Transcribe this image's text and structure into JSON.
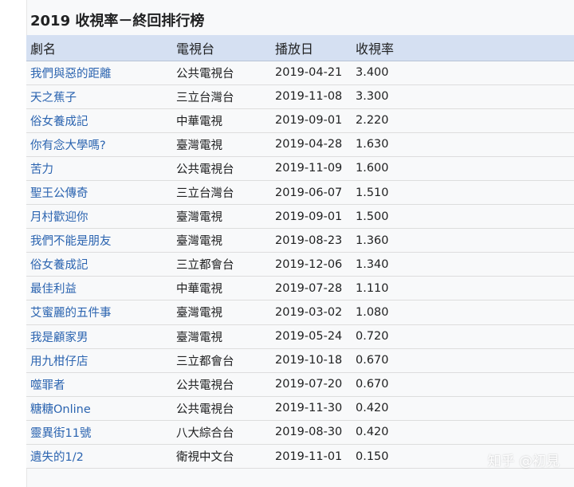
{
  "title": "2019 收視率－終回排行榜",
  "headers": [
    "劇名",
    "電視台",
    "播放日",
    "收視率"
  ],
  "rows": [
    {
      "drama": "我們與惡的距離",
      "channel": "公共電視台",
      "date": "2019-04-21",
      "rating": "3.400"
    },
    {
      "drama": "天之蕉子",
      "channel": "三立台灣台",
      "date": "2019-11-08",
      "rating": "3.300"
    },
    {
      "drama": "俗女養成記",
      "channel": "中華電視",
      "date": "2019-09-01",
      "rating": "2.220"
    },
    {
      "drama": "你有念大學嗎?",
      "channel": "臺灣電視",
      "date": "2019-04-28",
      "rating": "1.630"
    },
    {
      "drama": "苦力",
      "channel": "公共電視台",
      "date": "2019-11-09",
      "rating": "1.600"
    },
    {
      "drama": "聖王公傳奇",
      "channel": "三立台灣台",
      "date": "2019-06-07",
      "rating": "1.510"
    },
    {
      "drama": "月村歡迎你",
      "channel": "臺灣電視",
      "date": "2019-09-01",
      "rating": "1.500"
    },
    {
      "drama": "我們不能是朋友",
      "channel": "臺灣電視",
      "date": "2019-08-23",
      "rating": "1.360"
    },
    {
      "drama": "俗女養成記",
      "channel": "三立都會台",
      "date": "2019-12-06",
      "rating": "1.340"
    },
    {
      "drama": "最佳利益",
      "channel": "中華電視",
      "date": "2019-07-28",
      "rating": "1.110"
    },
    {
      "drama": "艾蜜麗的五件事",
      "channel": "臺灣電視",
      "date": "2019-03-02",
      "rating": "1.080"
    },
    {
      "drama": "我是顧家男",
      "channel": "臺灣電視",
      "date": "2019-05-24",
      "rating": "0.720"
    },
    {
      "drama": "用九柑仔店",
      "channel": "三立都會台",
      "date": "2019-10-18",
      "rating": "0.670"
    },
    {
      "drama": "噬罪者",
      "channel": "公共電視台",
      "date": "2019-07-20",
      "rating": "0.670"
    },
    {
      "drama": "糖糖Online",
      "channel": "公共電視台",
      "date": "2019-11-30",
      "rating": "0.420"
    },
    {
      "drama": "靈異街11號",
      "channel": "八大綜合台",
      "date": "2019-08-30",
      "rating": "0.420"
    },
    {
      "drama": "遺失的1/2",
      "channel": "衛視中文台",
      "date": "2019-11-01",
      "rating": "0.150"
    }
  ],
  "watermark": "知乎 @初見",
  "colors": {
    "header_bg": "#d5e0f2",
    "link": "#2b64b0",
    "text": "#202122",
    "row_bg": "#f8f9fa"
  }
}
